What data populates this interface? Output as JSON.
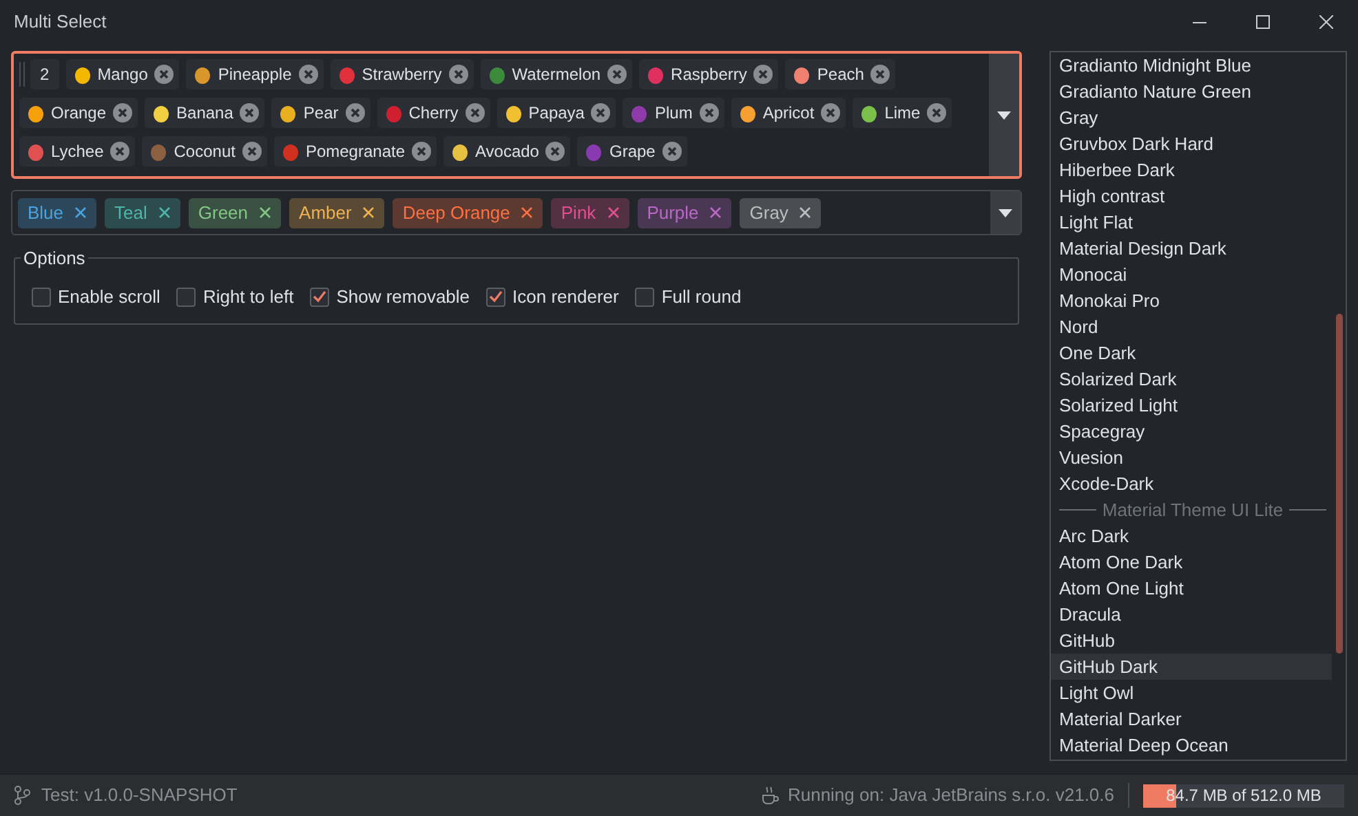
{
  "window": {
    "title": "Multi Select"
  },
  "fruit_select": {
    "count": "2",
    "items": [
      {
        "label": "Mango",
        "color": "#f5b800"
      },
      {
        "label": "Pineapple",
        "color": "#d9962b"
      },
      {
        "label": "Strawberry",
        "color": "#e0303c"
      },
      {
        "label": "Watermelon",
        "color": "#3c8a3c"
      },
      {
        "label": "Raspberry",
        "color": "#e03060"
      },
      {
        "label": "Peach",
        "color": "#f08070"
      },
      {
        "label": "Orange",
        "color": "#f5a00a"
      },
      {
        "label": "Banana",
        "color": "#f0d040"
      },
      {
        "label": "Pear",
        "color": "#e8b020"
      },
      {
        "label": "Cherry",
        "color": "#d02030"
      },
      {
        "label": "Papaya",
        "color": "#f0c030"
      },
      {
        "label": "Plum",
        "color": "#8e3aa8"
      },
      {
        "label": "Apricot",
        "color": "#f5a030"
      },
      {
        "label": "Lime",
        "color": "#7ac04a"
      },
      {
        "label": "Lychee",
        "color": "#e05050"
      },
      {
        "label": "Coconut",
        "color": "#8a6040"
      },
      {
        "label": "Pomegranate",
        "color": "#d03020"
      },
      {
        "label": "Avocado",
        "color": "#e6c040"
      },
      {
        "label": "Grape",
        "color": "#8a3ab0"
      }
    ]
  },
  "color_select": {
    "items": [
      {
        "label": "Blue",
        "color": "#4aa3df"
      },
      {
        "label": "Teal",
        "color": "#4db6ac"
      },
      {
        "label": "Green",
        "color": "#81c784"
      },
      {
        "label": "Amber",
        "color": "#f0b24f"
      },
      {
        "label": "Deep Orange",
        "color": "#ff7043"
      },
      {
        "label": "Pink",
        "color": "#e0508a"
      },
      {
        "label": "Purple",
        "color": "#ba68c8"
      },
      {
        "label": "Gray",
        "color": "#bdbdbd"
      }
    ]
  },
  "options": {
    "title": "Options",
    "checkboxes": [
      {
        "label": "Enable scroll",
        "checked": false
      },
      {
        "label": "Right to left",
        "checked": false
      },
      {
        "label": "Show removable",
        "checked": true
      },
      {
        "label": "Icon renderer",
        "checked": true
      },
      {
        "label": "Full round",
        "checked": false
      }
    ]
  },
  "theme_list": [
    {
      "kind": "item",
      "label": "Gradianto Midnight Blue",
      "selected": false
    },
    {
      "kind": "item",
      "label": "Gradianto Nature Green",
      "selected": false
    },
    {
      "kind": "item",
      "label": "Gray",
      "selected": false
    },
    {
      "kind": "item",
      "label": "Gruvbox Dark Hard",
      "selected": false
    },
    {
      "kind": "item",
      "label": "Hiberbee Dark",
      "selected": false
    },
    {
      "kind": "item",
      "label": "High contrast",
      "selected": false
    },
    {
      "kind": "item",
      "label": "Light Flat",
      "selected": false
    },
    {
      "kind": "item",
      "label": "Material Design Dark",
      "selected": false
    },
    {
      "kind": "item",
      "label": "Monocai",
      "selected": false
    },
    {
      "kind": "item",
      "label": "Monokai Pro",
      "selected": false
    },
    {
      "kind": "item",
      "label": "Nord",
      "selected": false
    },
    {
      "kind": "item",
      "label": "One Dark",
      "selected": false
    },
    {
      "kind": "item",
      "label": "Solarized Dark",
      "selected": false
    },
    {
      "kind": "item",
      "label": "Solarized Light",
      "selected": false
    },
    {
      "kind": "item",
      "label": "Spacegray",
      "selected": false
    },
    {
      "kind": "item",
      "label": "Vuesion",
      "selected": false
    },
    {
      "kind": "item",
      "label": "Xcode-Dark",
      "selected": false
    },
    {
      "kind": "separator",
      "label": "Material Theme UI Lite"
    },
    {
      "kind": "item",
      "label": "Arc Dark",
      "selected": false
    },
    {
      "kind": "item",
      "label": "Atom One Dark",
      "selected": false
    },
    {
      "kind": "item",
      "label": "Atom One Light",
      "selected": false
    },
    {
      "kind": "item",
      "label": "Dracula",
      "selected": false
    },
    {
      "kind": "item",
      "label": "GitHub",
      "selected": false
    },
    {
      "kind": "item",
      "label": "GitHub Dark",
      "selected": true
    },
    {
      "kind": "item",
      "label": "Light Owl",
      "selected": false
    },
    {
      "kind": "item",
      "label": "Material Darker",
      "selected": false
    },
    {
      "kind": "item",
      "label": "Material Deep Ocean",
      "selected": false
    }
  ],
  "status_bar": {
    "version": "Test: v1.0.0-SNAPSHOT",
    "runtime": "Running on: Java JetBrains s.r.o. v21.0.6",
    "memory": {
      "text": "84.7 MB of 512.0 MB",
      "level": 0.165
    }
  }
}
